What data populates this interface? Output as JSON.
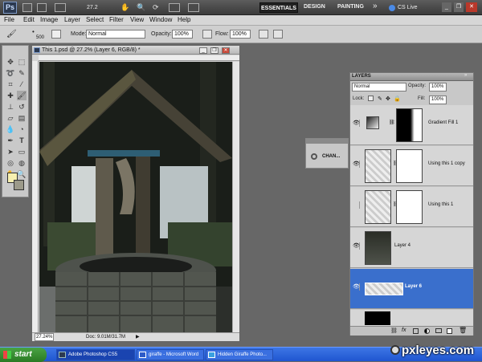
{
  "app": {
    "logo": "Ps",
    "zoom": "27.2",
    "workspaces": [
      "ESSENTIALS",
      "DESIGN",
      "PAINTING"
    ],
    "more": "»",
    "cslive": "CS Live"
  },
  "menu": [
    "File",
    "Edit",
    "Image",
    "Layer",
    "Select",
    "Filter",
    "View",
    "Window",
    "Help"
  ],
  "options": {
    "brush_size": "500",
    "mode_label": "Mode:",
    "mode_value": "Normal",
    "opacity_label": "Opacity:",
    "opacity_value": "100%",
    "flow_label": "Flow:",
    "flow_value": "100%"
  },
  "document": {
    "title": "This 1.psd @ 27.2% (Layer 6, RGB/8) *",
    "zoom": "27.24%",
    "doc_info": "Doc: 9.01M/31.7M"
  },
  "channels": {
    "label": "CHAN..."
  },
  "layers_panel": {
    "tab": "LAYERS",
    "blend_mode": "Normal",
    "opacity_label": "Opacity:",
    "opacity_value": "100%",
    "lock_label": "Lock:",
    "fill_label": "Fill:",
    "fill_value": "100%",
    "layers": [
      {
        "name": "Gradient Fill 1",
        "visible": true
      },
      {
        "name": "Using this 1 copy",
        "visible": true
      },
      {
        "name": "Using this 1",
        "visible": false
      },
      {
        "name": "Layer 4",
        "visible": true
      },
      {
        "name": "Layer 6",
        "visible": true,
        "selected": true
      }
    ],
    "footer_icons": [
      "link-icon",
      "fx-icon",
      "mask-icon",
      "adjustment-icon",
      "folder-icon",
      "new-layer-icon",
      "trash-icon"
    ]
  },
  "taskbar": {
    "start": "start",
    "tasks": [
      "Adobe Photoshop CS5",
      "giraffe - Microsoft Word",
      "Hidden Giraffe Photo..."
    ]
  },
  "watermark": "pxleyes.com",
  "colors": {
    "selection": "#3a6fcc",
    "taskbar": "#245edc",
    "start": "#3c8f35"
  }
}
